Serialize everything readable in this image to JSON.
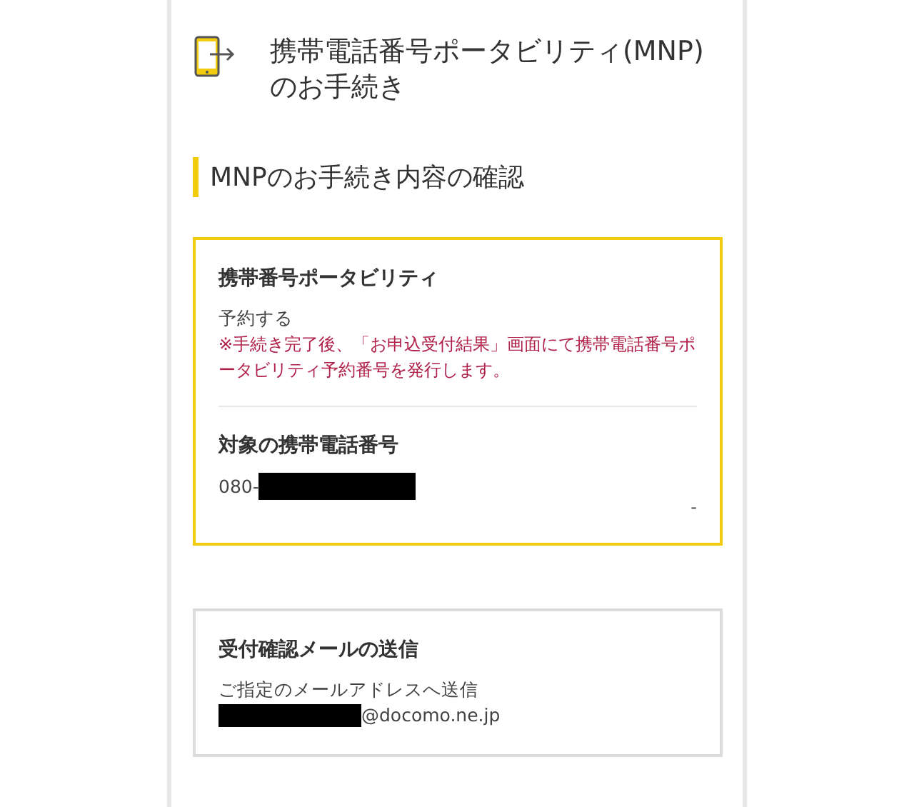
{
  "header": {
    "title": "携帯電話番号ポータビリティ(MNP)のお手続き"
  },
  "section": {
    "heading": "MNPのお手続き内容の確認"
  },
  "cards": [
    {
      "kind": "highlight",
      "items": [
        {
          "label": "携帯番号ポータビリティ",
          "value": "予約する",
          "note": "※手続き完了後、「お申込受付結果」画面にて携帯電話番号ポータビリティ予約番号を発行します。"
        },
        {
          "label": "対象の携帯電話番号",
          "value": "080-",
          "value_redacted": true,
          "trailing": "-"
        }
      ]
    },
    {
      "kind": "plain",
      "items": [
        {
          "label": "受付確認メールの送信",
          "value": "ご指定のメールアドレスへ送信",
          "email_suffix": "@docomo.ne.jp",
          "email_redacted": true
        }
      ]
    }
  ]
}
